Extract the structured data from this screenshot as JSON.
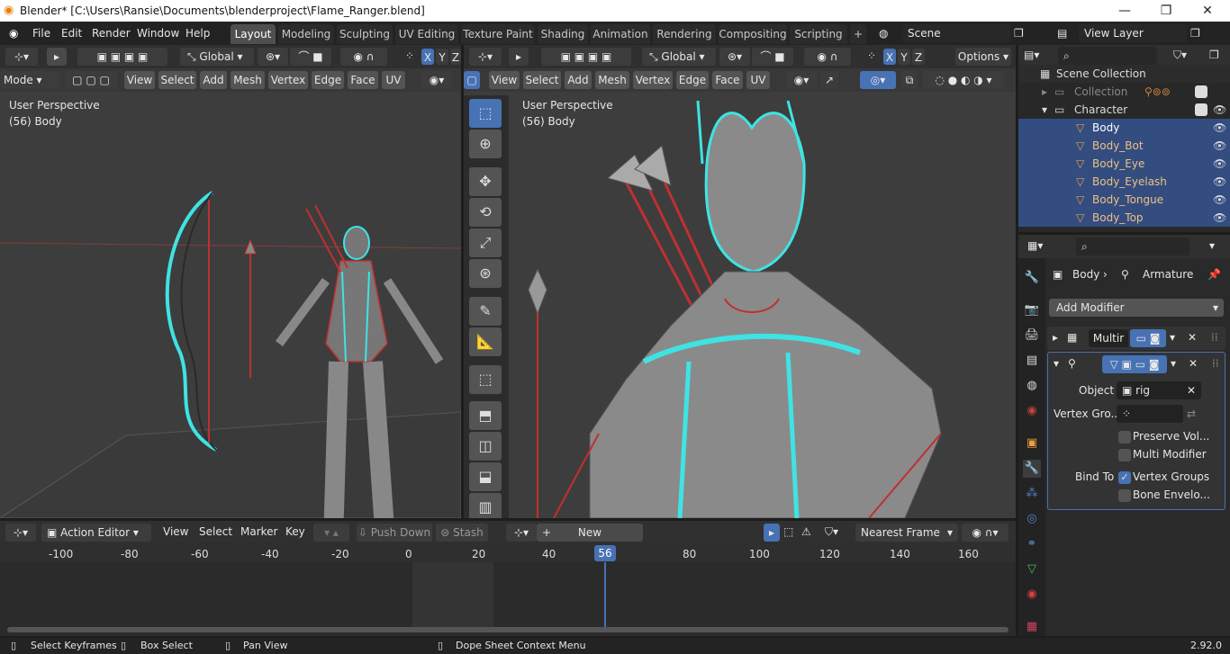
{
  "window": {
    "title": "Blender* [C:\\Users\\Ransie\\Documents\\blenderproject\\Flame_Ranger.blend]",
    "min": "—",
    "max": "❐",
    "close": "✕"
  },
  "menu": {
    "file": "File",
    "edit": "Edit",
    "render": "Render",
    "window": "Window",
    "help": "Help"
  },
  "tabs": [
    "Layout",
    "Modeling",
    "Sculpting",
    "UV Editing",
    "Texture Paint",
    "Shading",
    "Animation",
    "Rendering",
    "Compositing",
    "Scripting"
  ],
  "add_tab": "+",
  "scene": "Scene",
  "view_layer": "View Layer",
  "left_view": {
    "mode": "Mode",
    "orientation": "Global",
    "menus": [
      "View",
      "Select",
      "Add",
      "Mesh",
      "Vertex",
      "Edge",
      "Face",
      "UV"
    ],
    "overlay1": "User Perspective",
    "overlay2": "(56) Body",
    "axes": [
      "X",
      "Y",
      "Z"
    ]
  },
  "right_view": {
    "orientation": "Global",
    "options": "Options",
    "menus": [
      "View",
      "Select",
      "Add",
      "Mesh",
      "Vertex",
      "Edge",
      "Face",
      "UV"
    ],
    "overlay1": "User Perspective",
    "overlay2": "(56) Body",
    "axes": [
      "X",
      "Y",
      "Z"
    ]
  },
  "outliner": {
    "rows": [
      {
        "label": "Scene Collection",
        "indent": 0,
        "sel": false
      },
      {
        "label": "Collection",
        "indent": 1,
        "sel": false,
        "dim": true
      },
      {
        "label": "Character",
        "indent": 1,
        "sel": false
      },
      {
        "label": "Body",
        "indent": 2,
        "sel": true
      },
      {
        "label": "Body_Bot",
        "indent": 2,
        "sel": true
      },
      {
        "label": "Body_Eye",
        "indent": 2,
        "sel": true
      },
      {
        "label": "Body_Eyelash",
        "indent": 2,
        "sel": true
      },
      {
        "label": "Body_Tongue",
        "indent": 2,
        "sel": true
      },
      {
        "label": "Body_Top",
        "indent": 2,
        "sel": true
      }
    ]
  },
  "properties": {
    "breadcrumb_obj": "Body",
    "breadcrumb_mod": "Armature",
    "add_modifier": "Add Modifier",
    "mod1": "Multir",
    "object_label": "Object",
    "object_value": "rig",
    "vgroup_label": "Vertex Gro...",
    "preserve": "Preserve Vol...",
    "multi_modifier": "Multi Modifier",
    "bind_to": "Bind To",
    "vertex_groups": "Vertex Groups",
    "bone_envelope": "Bone Envelo..."
  },
  "timeline": {
    "editor": "Action Editor",
    "menus": [
      "View",
      "Select",
      "Marker",
      "Key"
    ],
    "push_down": "Push Down",
    "stash": "Stash",
    "new_label": "New",
    "snap": "Nearest Frame",
    "current_frame": "56",
    "ticks": [
      "-100",
      "-80",
      "-60",
      "-40",
      "-20",
      "0",
      "20",
      "40",
      "80",
      "100",
      "120",
      "140",
      "160"
    ]
  },
  "status": {
    "select": "Select Keyframes",
    "box": "Box Select",
    "pan": "Pan View",
    "context": "Dope Sheet Context Menu",
    "version": "2.92.0"
  }
}
